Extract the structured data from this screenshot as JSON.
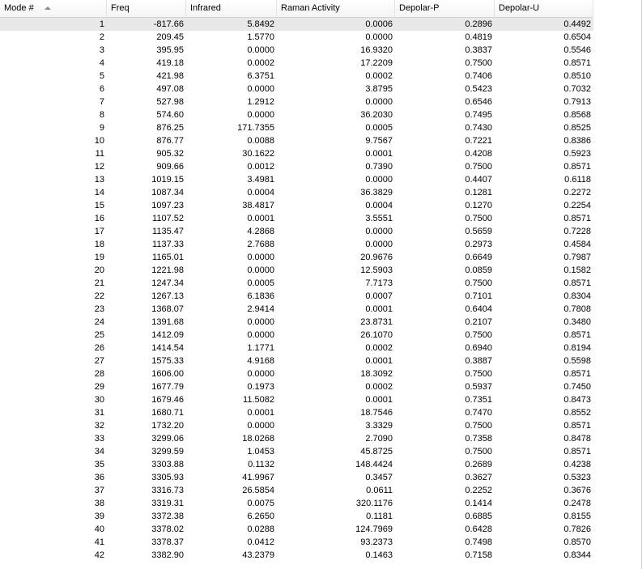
{
  "table": {
    "columns": [
      {
        "label": "Mode #",
        "sorted": "ascending"
      },
      {
        "label": "Freq"
      },
      {
        "label": "Infrared"
      },
      {
        "label": "Raman Activity"
      },
      {
        "label": "Depolar-P"
      },
      {
        "label": "Depolar-U"
      }
    ],
    "selected_row": 0,
    "rows": [
      [
        "1",
        "-817.66",
        "5.8492",
        "0.0006",
        "0.2896",
        "0.4492"
      ],
      [
        "2",
        "209.45",
        "1.5770",
        "0.0000",
        "0.4819",
        "0.6504"
      ],
      [
        "3",
        "395.95",
        "0.0000",
        "16.9320",
        "0.3837",
        "0.5546"
      ],
      [
        "4",
        "419.18",
        "0.0002",
        "17.2209",
        "0.7500",
        "0.8571"
      ],
      [
        "5",
        "421.98",
        "6.3751",
        "0.0002",
        "0.7406",
        "0.8510"
      ],
      [
        "6",
        "497.08",
        "0.0000",
        "3.8795",
        "0.5423",
        "0.7032"
      ],
      [
        "7",
        "527.98",
        "1.2912",
        "0.0000",
        "0.6546",
        "0.7913"
      ],
      [
        "8",
        "574.60",
        "0.0000",
        "36.2030",
        "0.7495",
        "0.8568"
      ],
      [
        "9",
        "876.25",
        "171.7355",
        "0.0005",
        "0.7430",
        "0.8525"
      ],
      [
        "10",
        "876.77",
        "0.0088",
        "9.7567",
        "0.7221",
        "0.8386"
      ],
      [
        "11",
        "905.32",
        "30.1622",
        "0.0001",
        "0.4208",
        "0.5923"
      ],
      [
        "12",
        "909.66",
        "0.0012",
        "0.7390",
        "0.7500",
        "0.8571"
      ],
      [
        "13",
        "1019.15",
        "3.4981",
        "0.0000",
        "0.4407",
        "0.6118"
      ],
      [
        "14",
        "1087.34",
        "0.0004",
        "36.3829",
        "0.1281",
        "0.2272"
      ],
      [
        "15",
        "1097.23",
        "38.4817",
        "0.0004",
        "0.1270",
        "0.2254"
      ],
      [
        "16",
        "1107.52",
        "0.0001",
        "3.5551",
        "0.7500",
        "0.8571"
      ],
      [
        "17",
        "1135.47",
        "4.2868",
        "0.0000",
        "0.5659",
        "0.7228"
      ],
      [
        "18",
        "1137.33",
        "2.7688",
        "0.0000",
        "0.2973",
        "0.4584"
      ],
      [
        "19",
        "1165.01",
        "0.0000",
        "20.9676",
        "0.6649",
        "0.7987"
      ],
      [
        "20",
        "1221.98",
        "0.0000",
        "12.5903",
        "0.0859",
        "0.1582"
      ],
      [
        "21",
        "1247.34",
        "0.0005",
        "7.7173",
        "0.7500",
        "0.8571"
      ],
      [
        "22",
        "1267.13",
        "6.1836",
        "0.0007",
        "0.7101",
        "0.8304"
      ],
      [
        "23",
        "1368.07",
        "2.9414",
        "0.0001",
        "0.6404",
        "0.7808"
      ],
      [
        "24",
        "1391.68",
        "0.0000",
        "23.8731",
        "0.2107",
        "0.3480"
      ],
      [
        "25",
        "1412.09",
        "0.0000",
        "26.1070",
        "0.7500",
        "0.8571"
      ],
      [
        "26",
        "1414.54",
        "1.1771",
        "0.0002",
        "0.6940",
        "0.8194"
      ],
      [
        "27",
        "1575.33",
        "4.9168",
        "0.0001",
        "0.3887",
        "0.5598"
      ],
      [
        "28",
        "1606.00",
        "0.0000",
        "18.3092",
        "0.7500",
        "0.8571"
      ],
      [
        "29",
        "1677.79",
        "0.1973",
        "0.0002",
        "0.5937",
        "0.7450"
      ],
      [
        "30",
        "1679.46",
        "11.5082",
        "0.0001",
        "0.7351",
        "0.8473"
      ],
      [
        "31",
        "1680.71",
        "0.0001",
        "18.7546",
        "0.7470",
        "0.8552"
      ],
      [
        "32",
        "1732.20",
        "0.0000",
        "3.3329",
        "0.7500",
        "0.8571"
      ],
      [
        "33",
        "3299.06",
        "18.0268",
        "2.7090",
        "0.7358",
        "0.8478"
      ],
      [
        "34",
        "3299.59",
        "1.0453",
        "45.8725",
        "0.7500",
        "0.8571"
      ],
      [
        "35",
        "3303.88",
        "0.1132",
        "148.4424",
        "0.2689",
        "0.4238"
      ],
      [
        "36",
        "3305.93",
        "41.9967",
        "0.3457",
        "0.3627",
        "0.5323"
      ],
      [
        "37",
        "3316.73",
        "26.5854",
        "0.0611",
        "0.2252",
        "0.3676"
      ],
      [
        "38",
        "3319.31",
        "0.0075",
        "320.1176",
        "0.1414",
        "0.2478"
      ],
      [
        "39",
        "3372.38",
        "6.2650",
        "0.1181",
        "0.6885",
        "0.8155"
      ],
      [
        "40",
        "3378.02",
        "0.0288",
        "124.7969",
        "0.6428",
        "0.7826"
      ],
      [
        "41",
        "3378.37",
        "0.0412",
        "93.2373",
        "0.7498",
        "0.8570"
      ],
      [
        "42",
        "3382.90",
        "43.2379",
        "0.1463",
        "0.7158",
        "0.8344"
      ]
    ]
  }
}
